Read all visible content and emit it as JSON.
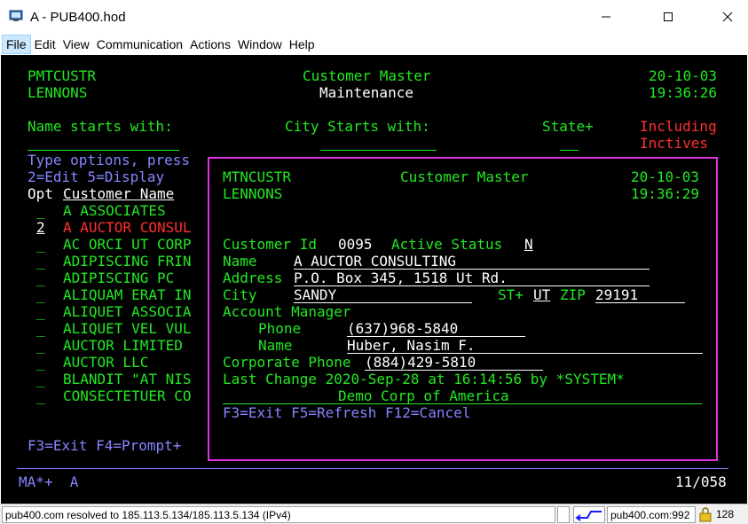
{
  "window": {
    "title": "A - PUB400.hod"
  },
  "menu": [
    "File",
    "Edit",
    "View",
    "Communication",
    "Actions",
    "Window",
    "Help"
  ],
  "main_screen": {
    "program": "PMTCUSTR",
    "user": "LENNONS",
    "title1": "Customer Master",
    "title2": "Maintenance",
    "date": "20-10-03",
    "time": "19:36:26",
    "name_label": "Name starts with:",
    "city_label": "City Starts with:",
    "state_label": "State+",
    "including_label1": "Including",
    "including_label2": "Inctives",
    "type_options": "Type options, press",
    "options_line": "2=Edit 5=Display",
    "opt_header": "Opt",
    "name_header": "Customer Name",
    "rows": [
      {
        "opt": "_",
        "name": "A ASSOCIATES"
      },
      {
        "opt": "2",
        "name": "A AUCTOR CONSUL"
      },
      {
        "opt": "_",
        "name": "AC ORCI UT CORP"
      },
      {
        "opt": "_",
        "name": "ADIPISCING FRIN"
      },
      {
        "opt": "_",
        "name": "ADIPISCING PC"
      },
      {
        "opt": "_",
        "name": "ALIQUAM ERAT IN"
      },
      {
        "opt": "_",
        "name": "ALIQUET ASSOCIA"
      },
      {
        "opt": "_",
        "name": "ALIQUET VEL VUL"
      },
      {
        "opt": "_",
        "name": "AUCTOR LIMITED"
      },
      {
        "opt": "_",
        "name": "AUCTOR LLC"
      },
      {
        "opt": "_",
        "name": "BLANDIT \"AT NIS"
      },
      {
        "opt": "_",
        "name": "CONSECTETUER CO"
      }
    ],
    "fkeys": "F3=Exit F4=Prompt+"
  },
  "popup": {
    "program": "MTNCUSTR",
    "user": "LENNONS",
    "title": "Customer Master",
    "date": "20-10-03",
    "time": "19:36:29",
    "customer_id_label": "Customer Id",
    "customer_id": "0095",
    "active_status_label": "Active Status",
    "active_status": "N",
    "name_label": "Name",
    "name": "A AUCTOR CONSULTING",
    "address_label": "Address",
    "address": "P.O. Box 345, 1518 Ut Rd.",
    "city_label": "City",
    "city": "SANDY",
    "state_label": "ST+",
    "state": "UT",
    "zip_label": "ZIP",
    "zip": "29191",
    "account_manager_label": "Account Manager",
    "phone_label": "Phone",
    "phone": "(637)968-5840",
    "mgr_name_label": "Name",
    "mgr_name": "Huber, Nasim F.",
    "corp_phone_label": "Corporate Phone",
    "corp_phone": "(884)429-5810",
    "last_change": "Last Change 2020-Sep-28 at 16:14:56 by *SYSTEM*",
    "company": "Demo Corp of America",
    "fkeys": "F3=Exit F5=Refresh F12=Cancel"
  },
  "oia": {
    "left": "MA*+  A",
    "position": "11/058"
  },
  "statusbar": {
    "message": "pub400.com resolved to 185.113.5.134/185.113.5.134 (IPv4)",
    "host": "pub400.com:992",
    "encryption": "128"
  },
  "colors": {
    "green": "#22e822",
    "white": "#ffffff",
    "blue": "#8585ff",
    "red": "#ff3030",
    "magenta": "#e030e0"
  }
}
